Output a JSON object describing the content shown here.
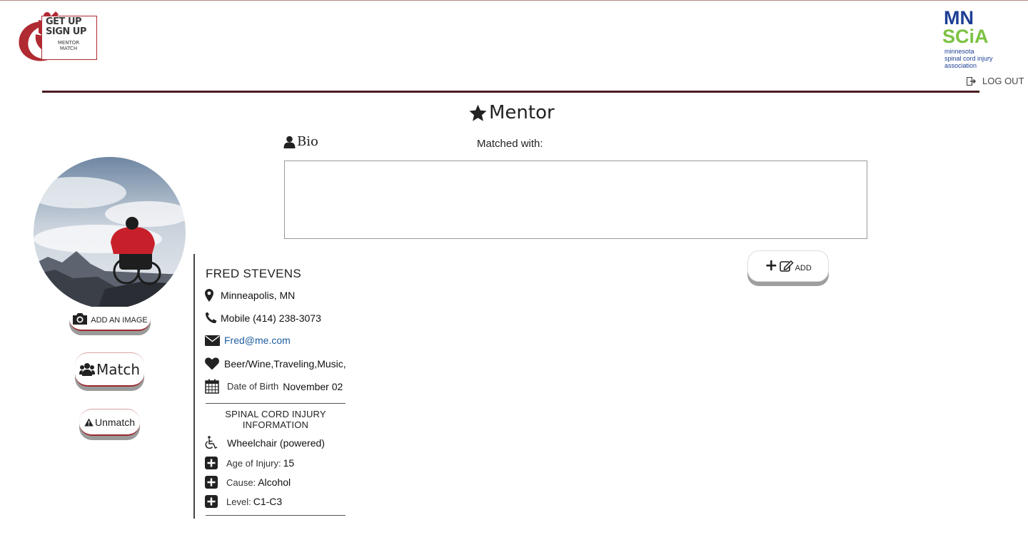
{
  "header": {
    "left_logo": {
      "line1": "GET UP",
      "line2": "SIGN UP",
      "line3": "MENTOR",
      "line4": "MATCH"
    },
    "right_logo": {
      "mn": "MN",
      "scia": "SCiA",
      "sub1": "minnesota",
      "sub2": "spinal cord injury",
      "sub3": "association"
    },
    "logout_label": "LOG OUT"
  },
  "page": {
    "role_heading": "Mentor",
    "bio_heading": "Bio",
    "matched_with_label": "Matched with:",
    "add_button_label": "ADD"
  },
  "profile": {
    "add_image_label": "ADD AN IMAGE",
    "match_label": "Match",
    "unmatch_label": "Unmatch",
    "name": "FRED STEVENS",
    "location": "Minneapolis, MN",
    "phone": "Mobile (414) 238-3073",
    "email": "Fred@me.com",
    "interests": "Beer/Wine,Traveling,Music,",
    "dob_label": "Date of Birth",
    "dob_value": "November 02"
  },
  "injury": {
    "section_title": "SPINAL CORD INJURY INFORMATION",
    "mobility": "Wheelchair (powered)",
    "age_label": "Age of Injury:",
    "age_value": "15",
    "cause_label": "Cause:",
    "cause_value": "Alcohol",
    "level_label": "Level:",
    "level_value": "C1-C3"
  },
  "colors": {
    "brand_red": "#b02a32",
    "divider": "#4a1c1f",
    "mn_blue": "#1d3f94",
    "scia_green": "#7cc242",
    "link_blue": "#1f5fa0"
  }
}
